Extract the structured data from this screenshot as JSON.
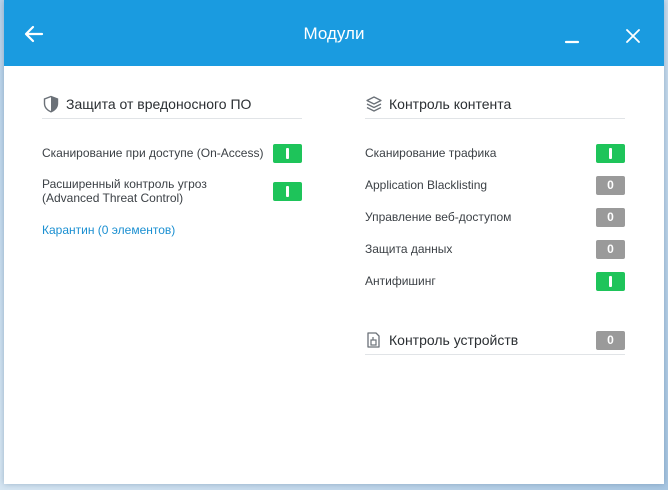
{
  "window": {
    "title": "Модули"
  },
  "malware": {
    "header": "Защита от вредоносного ПО",
    "items": [
      {
        "label": "Сканирование при доступе (On-Access)",
        "state": "on"
      },
      {
        "label_line1": "Расширенный контроль угроз",
        "label_line2": "(Advanced Threat Control)",
        "state": "on"
      }
    ],
    "quarantine_link": "Карантин (0 элементов)"
  },
  "content": {
    "header": "Контроль контента",
    "items": [
      {
        "label": "Сканирование трафика",
        "state": "on",
        "toggle_text": ""
      },
      {
        "label": "Application Blacklisting",
        "state": "off",
        "toggle_text": "0"
      },
      {
        "label": "Управление веб-доступом",
        "state": "off",
        "toggle_text": "0"
      },
      {
        "label": "Защита данных",
        "state": "off",
        "toggle_text": "0"
      },
      {
        "label": "Антифишинг",
        "state": "on",
        "toggle_text": ""
      }
    ]
  },
  "devices": {
    "header": "Контроль устройств",
    "state": "off",
    "toggle_text": "0"
  },
  "colors": {
    "titlebar": "#1a9be0",
    "on": "#1ec45a",
    "off": "#9a9a9a",
    "link": "#1a8fd1"
  }
}
